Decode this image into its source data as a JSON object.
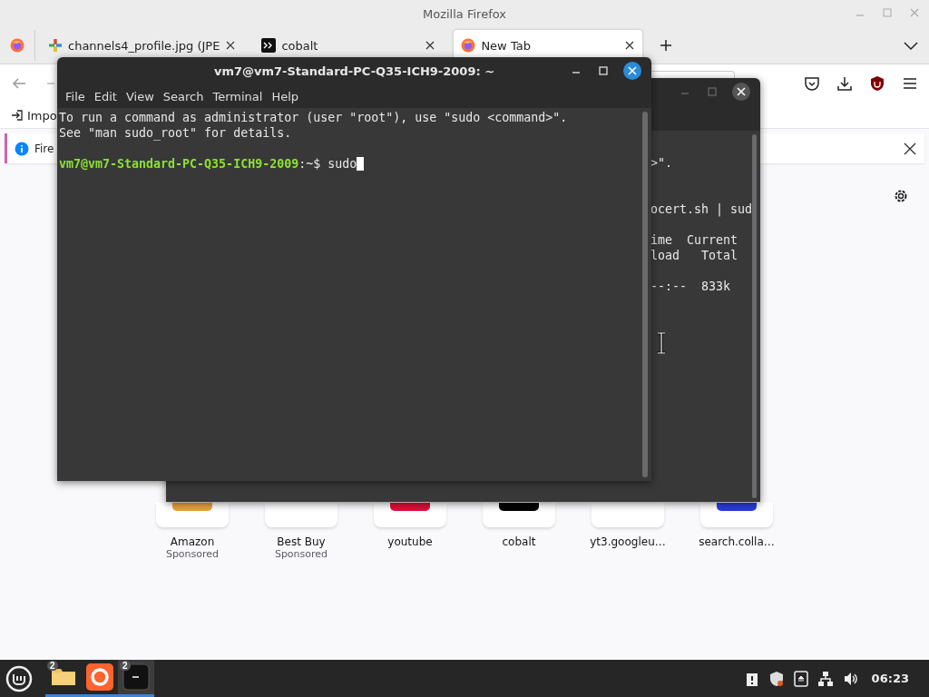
{
  "window": {
    "title": "Mozilla Firefox"
  },
  "tabs": [
    {
      "label": "channels4_profile.jpg (JPE",
      "selected": false,
      "kind": "image"
    },
    {
      "label": "cobalt",
      "selected": false,
      "kind": "terminal"
    },
    {
      "label": "New Tab",
      "selected": true,
      "kind": "firefox"
    }
  ],
  "bookmarks": [
    {
      "label": "Impo"
    }
  ],
  "notification": {
    "text": "Fire"
  },
  "shortcuts": [
    {
      "label": "Amazon",
      "sponsor": "Sponsored",
      "color": "#e8a33a"
    },
    {
      "label": "Best Buy",
      "sponsor": "Sponsored"
    },
    {
      "label": "youtube",
      "color": "#e0103a"
    },
    {
      "label": "cobalt",
      "color": "#000000"
    },
    {
      "label": "yt3.googleu…"
    },
    {
      "label": "search.colla…",
      "color": "#2a3be0"
    }
  ],
  "back_terminal": {
    "lines": [
      {
        "kind": "text",
        "text": ">\"."
      },
      {
        "kind": "blank"
      },
      {
        "kind": "blank"
      },
      {
        "kind": "text",
        "text": "ocert.sh | sud"
      },
      {
        "kind": "blank"
      },
      {
        "kind": "text",
        "text": "ime  Current"
      },
      {
        "kind": "text",
        "text": "load   Total"
      },
      {
        "kind": "blank"
      },
      {
        "kind": "text",
        "text": "--:--  833k"
      }
    ]
  },
  "terminal": {
    "title": "vm7@vm7-Standard-PC-Q35-ICH9-2009: ~",
    "menu": [
      "File",
      "Edit",
      "View",
      "Search",
      "Terminal",
      "Help"
    ],
    "lines": [
      {
        "kind": "text",
        "text": "To run a command as administrator (user \"root\"), use \"sudo <command>\"."
      },
      {
        "kind": "text",
        "text": "See \"man sudo_root\" for details."
      },
      {
        "kind": "blank"
      },
      {
        "kind": "prompt",
        "user": "vm7@vm7-Standard-PC-Q35-ICH9-2009",
        "path": ":~$",
        "command": "sudo"
      }
    ]
  },
  "taskbar": {
    "apps": [
      {
        "kind": "folder",
        "count": "2",
        "selected": false
      },
      {
        "kind": "firefox",
        "selected": false
      },
      {
        "kind": "terminal",
        "count": "2",
        "selected": true
      }
    ],
    "clock": "06:23"
  }
}
